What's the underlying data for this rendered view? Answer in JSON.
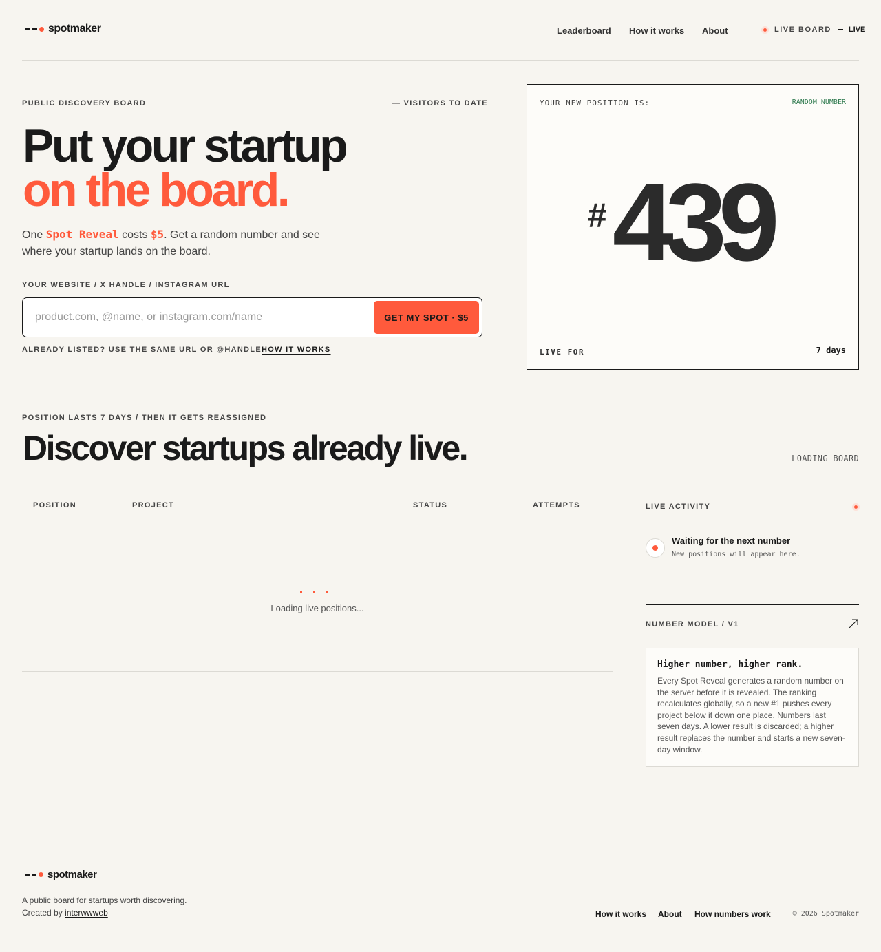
{
  "brand": {
    "name": "spotmaker",
    "accent": "#ff5a3c"
  },
  "nav": {
    "items": [
      "Leaderboard",
      "How it works",
      "About"
    ],
    "live_label": "LIVE BOARD",
    "live_status": "LIVE"
  },
  "hero": {
    "eyebrow": "PUBLIC DISCOVERY BOARD",
    "visitors": "— VISITORS TO DATE",
    "title_line1": "Put your startup",
    "title_line2": "on the board.",
    "lead_pre": "One ",
    "lead_hl1": "Spot Reveal",
    "lead_mid": " costs ",
    "lead_hl2": "$5",
    "lead_post": ". Get a random number and see where your startup lands on the board.",
    "input_label": "YOUR WEBSITE / X HANDLE / INSTAGRAM URL",
    "input_placeholder": "product.com, @name, or instagram.com/name",
    "cta_label": "GET MY SPOT · $5",
    "already_listed": "ALREADY LISTED? USE THE SAME URL OR @HANDLE",
    "how_link": "HOW IT WORKS"
  },
  "position_card": {
    "label": "YOUR NEW POSITION IS:",
    "tag": "RANDOM NUMBER",
    "tag_color": "#2f7a4f",
    "hash": "#",
    "number": "439",
    "live_for_label": "LIVE FOR",
    "live_for_value": "7 days"
  },
  "discover": {
    "eyebrow": "POSITION LASTS 7 DAYS / THEN IT GETS REASSIGNED",
    "title": "Discover startups already live.",
    "loading_board": "LOADING BOARD",
    "columns": [
      "POSITION",
      "PROJECT",
      "STATUS",
      "ATTEMPTS"
    ],
    "loading_text": "Loading live positions..."
  },
  "activity": {
    "title": "LIVE ACTIVITY",
    "item_title": "Waiting for the next number",
    "item_sub": "New positions will appear here."
  },
  "model": {
    "title": "NUMBER MODEL / V1",
    "heading": "Higher number, higher rank.",
    "body": "Every Spot Reveal generates a random number on the server before it is revealed. The ranking recalculates globally, so a new #1 pushes every project below it down one place. Numbers last seven days. A lower result is discarded; a higher result replaces the number and starts a new seven-day window."
  },
  "footer": {
    "tagline": "A public board for startups worth discovering.",
    "created_by": "Created by ",
    "creator": "interwwweb",
    "links": [
      "How it works",
      "About",
      "How numbers work"
    ],
    "copyright": "© 2026 Spotmaker"
  }
}
